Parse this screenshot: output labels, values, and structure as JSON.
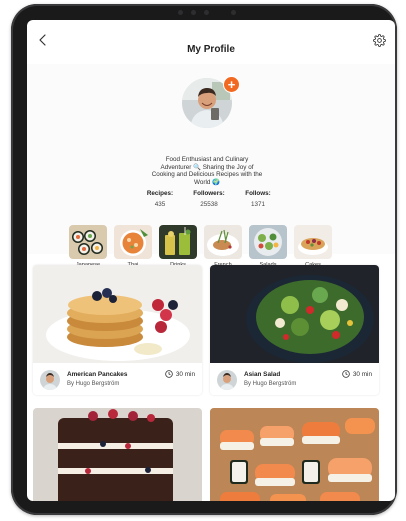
{
  "header": {
    "title": "My Profile"
  },
  "profile": {
    "bio_lines": [
      "Food Enthusiast and Culinary",
      "Adventurer 🔍 Sharing the Joy of",
      "Cooking and Delicious Recipes with the",
      "World 🌍"
    ],
    "stats": [
      {
        "label": "Recipes:",
        "value": "435"
      },
      {
        "label": "Followers:",
        "value": "25538"
      },
      {
        "label": "Follows:",
        "value": "1371"
      }
    ]
  },
  "categories": [
    {
      "label": "Japanese",
      "icon": "sushi-thumbnail"
    },
    {
      "label": "Thai",
      "icon": "thai-bowl-thumbnail"
    },
    {
      "label": "Drinks",
      "icon": "drinks-thumbnail"
    },
    {
      "label": "French",
      "icon": "french-dish-thumbnail"
    },
    {
      "label": "Salads",
      "icon": "salad-thumbnail"
    },
    {
      "label": "Cakes",
      "icon": "cake-thumbnail"
    }
  ],
  "recipes": [
    {
      "name": "American Pancakes",
      "author": "By Hugo Bergström",
      "time": "30 min"
    },
    {
      "name": "Asian Salad",
      "author": "By Hugo Bergström",
      "time": "30 min"
    }
  ],
  "colors": {
    "accent": "#f26a21",
    "device_frame": "#1a1a1b",
    "screen_bg": "#ffffff"
  }
}
